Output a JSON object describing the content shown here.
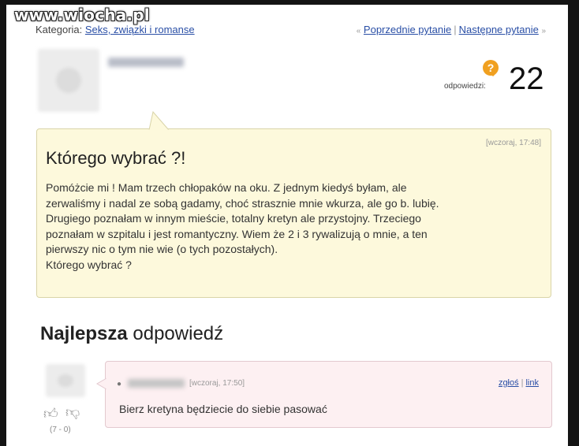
{
  "watermark": "www.wiocha.pl",
  "breadcrumb": {
    "label": "Kategoria:",
    "category": "Seks, związki i romanse"
  },
  "nav": {
    "prev": "Poprzednie pytanie",
    "next": "Następne pytanie"
  },
  "answers": {
    "label": "odpowiedzi:",
    "count": "22"
  },
  "question": {
    "time": "[wczoraj, 17:48]",
    "title": "Którego wybrać ?!",
    "lines": [
      "Pomóżcie mi ! Mam trzech chłopaków na oku. Z jednym kiedyś byłam, ale",
      "zerwaliśmy i nadal ze sobą gadamy, choć strasznie mnie wkurza, ale go b. lubię.",
      "Drugiego poznałam w innym mieście, totalny kretyn ale przystojny. Trzeciego",
      "poznałam w szpitalu i jest romantyczny. Wiem że 2 i 3 rywalizują o mnie, a ten",
      "pierwszy nic o tym nie wie (o tych pozostałych).",
      "Którego wybrać ?"
    ]
  },
  "best": {
    "title_bold": "Najlepsza",
    "title_rest": "odpowiedź"
  },
  "answer": {
    "time": "[wczoraj, 17:50]",
    "report": "zgłoś",
    "link": "link",
    "text": "Bierz kretyna będziecie do siebie pasować",
    "votes": "(7 - 0)"
  }
}
